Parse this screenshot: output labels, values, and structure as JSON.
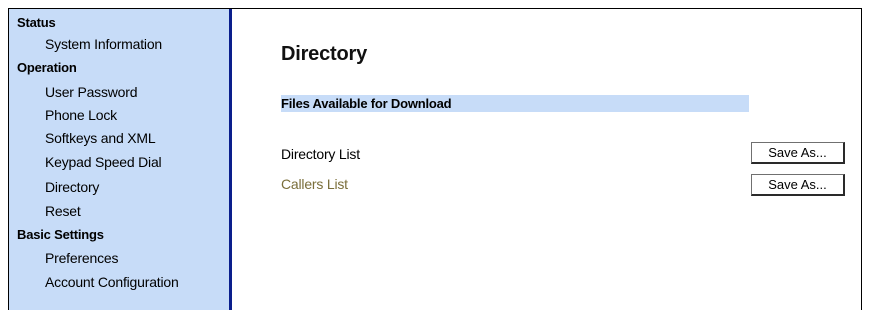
{
  "sidebar": {
    "groups": [
      {
        "label": "Status",
        "items": [
          {
            "label": "System Information"
          }
        ]
      },
      {
        "label": "Operation",
        "items": [
          {
            "label": "User Password"
          },
          {
            "label": "Phone Lock"
          },
          {
            "label": "Softkeys and XML"
          },
          {
            "label": "Keypad Speed Dial"
          },
          {
            "label": "Directory"
          },
          {
            "label": "Reset"
          }
        ]
      },
      {
        "label": "Basic Settings",
        "items": [
          {
            "label": "Preferences"
          },
          {
            "label": "Account Configuration"
          }
        ]
      }
    ]
  },
  "main": {
    "title": "Directory",
    "section_title": "Files Available for Download",
    "rows": [
      {
        "label": "Directory List",
        "button_label": "Save As..."
      },
      {
        "label": "Callers List",
        "button_label": "Save As..."
      }
    ]
  },
  "colors": {
    "sidebar_bg": "#c7dcf8",
    "sidebar_border": "#0a1e8c",
    "section_bar_bg": "#c7dcf8",
    "callers_list_text": "#7a6e3a"
  }
}
